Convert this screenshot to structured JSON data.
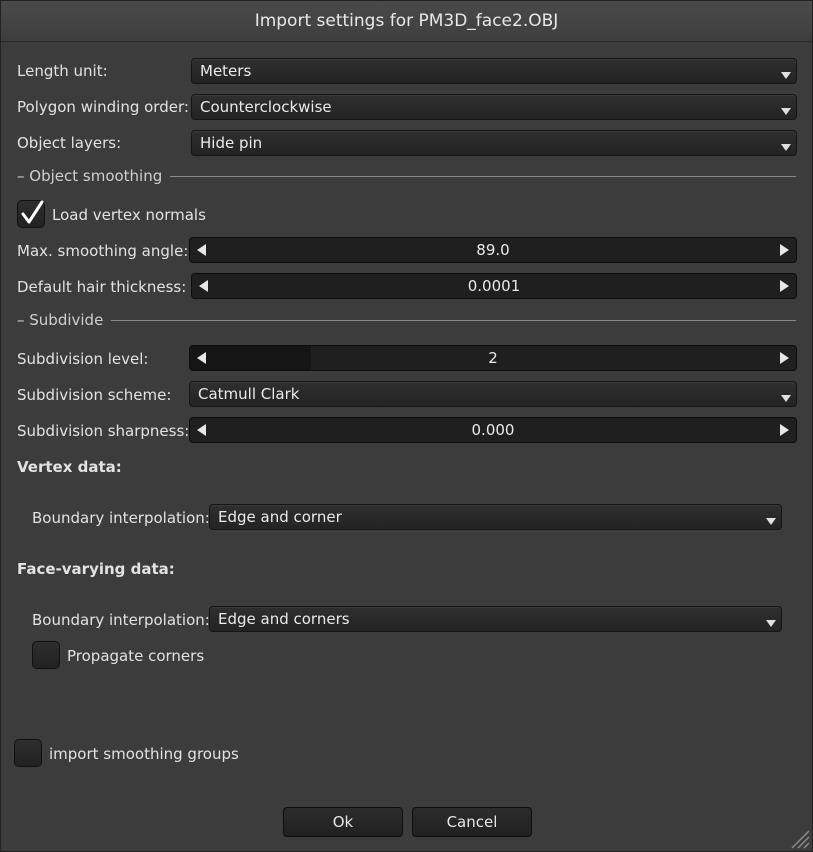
{
  "dialog": {
    "title": "Import settings for PM3D_face2.OBJ"
  },
  "general": {
    "length_unit_label": "Length unit:",
    "length_unit_value": "Meters",
    "winding_label": "Polygon winding order:",
    "winding_value": "Counterclockwise",
    "layers_label": "Object layers:",
    "layers_value": "Hide pin"
  },
  "smoothing": {
    "section_title": "– Object smoothing",
    "load_normals_label": "Load vertex normals",
    "load_normals_checked": true,
    "max_angle_label": "Max. smoothing angle:",
    "max_angle_value": "89.0",
    "hair_label": "Default hair thickness:",
    "hair_value": "0.0001"
  },
  "subdivide": {
    "section_title": "– Subdivide",
    "level_label": "Subdivision level:",
    "level_value": "2",
    "level_fill_fraction": 0.2,
    "scheme_label": "Subdivision scheme:",
    "scheme_value": "Catmull Clark",
    "sharpness_label": "Subdivision sharpness:",
    "sharpness_value": "0.000"
  },
  "vertex_data": {
    "heading": "Vertex data:",
    "boundary_label": "Boundary interpolation:",
    "boundary_value": "Edge and corner"
  },
  "face_varying": {
    "heading": "Face-varying data:",
    "boundary_label": "Boundary interpolation:",
    "boundary_value": "Edge and corners",
    "propagate_label": "Propagate corners",
    "propagate_checked": false
  },
  "smoothing_groups": {
    "label": "import smoothing groups",
    "checked": false
  },
  "buttons": {
    "ok": "Ok",
    "cancel": "Cancel"
  },
  "icons": {
    "dropdown": "chevron-down-icon",
    "decrement": "arrow-left-icon",
    "increment": "arrow-right-icon",
    "check": "checkmark-icon",
    "resize": "resize-grip-icon"
  }
}
